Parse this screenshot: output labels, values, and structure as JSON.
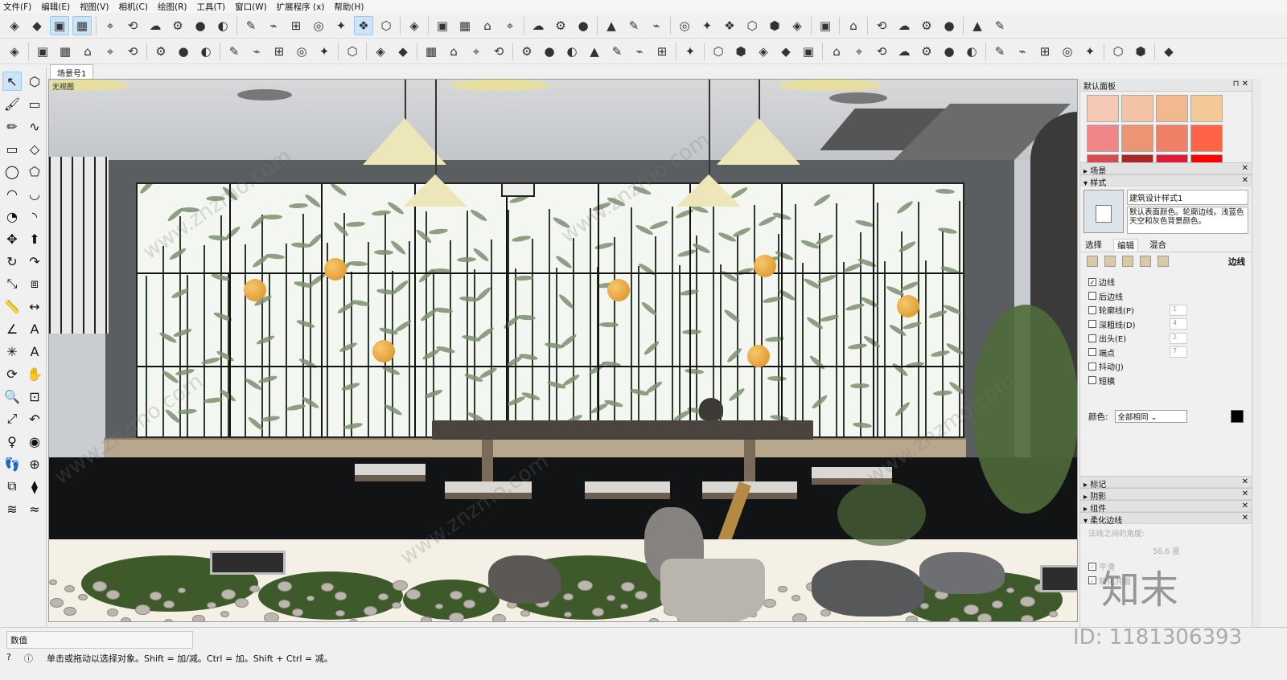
{
  "menu": [
    "文件(F)",
    "编辑(E)",
    "视图(V)",
    "相机(C)",
    "绘图(R)",
    "工具(T)",
    "窗口(W)",
    "扩展程序 (x)",
    "帮助(H)"
  ],
  "toolbar1_icons": [
    "select-icon",
    "box-icon",
    "box-active-icon",
    "box-active2-icon",
    "sep",
    "component-icon",
    "3d-icon",
    "home-icon",
    "toolbox-icon",
    "house-icon",
    "folder-icon",
    "sep",
    "cube-icon",
    "cube-outline-icon",
    "cube-left-icon",
    "cube-right-icon",
    "cube-face-icon",
    "cube-shaded-icon",
    "cube-blue-icon",
    "sep",
    "sandbox-icon",
    "sep",
    "cloud-link-icon",
    "cloud-search-icon",
    "cloud-icon",
    "cloud-share-icon",
    "sep",
    "zoom-extents-icon",
    "network-icon",
    "refresh-check-icon",
    "sep",
    "download-icon",
    "gear-icon",
    "chrome-icon",
    "sep",
    "dot-icon",
    "dot2-icon",
    "dot3-icon",
    "dot4-icon",
    "dot5-icon",
    "pinwheel-icon",
    "sep",
    "ruby-icon",
    "sep",
    "purple-circle-icon",
    "sep",
    "target-icon",
    "camera-icon",
    "camera2-icon",
    "timer-icon",
    "sep",
    "gear2-icon",
    "cube3-icon"
  ],
  "toolbar2_icons": [
    "layers-icon",
    "sep",
    "paper-icon",
    "paper2-icon",
    "paper3-icon",
    "paper4-icon",
    "paper5-icon",
    "sep",
    "vray-icon",
    "refresh-icon",
    "stack-icon",
    "sep",
    "plus-icon",
    "tree-icon",
    "pie-icon",
    "checker-icon",
    "cloud-up-icon",
    "sep",
    "gear3-icon",
    "sep",
    "mail-icon",
    "info-icon",
    "sep",
    "stairs-icon",
    "column-icon",
    "rail-icon",
    "bars-icon",
    "sep",
    "spider-icon",
    "beam-icon",
    "branch-icon",
    "branch2-icon",
    "arch-icon",
    "curl-icon",
    "snake-icon",
    "sep",
    "bench-icon",
    "sep",
    "line-tool-icon",
    "diamond-icon",
    "diamond2-icon",
    "house3-icon",
    "puzzle-icon",
    "sep",
    "arc-icon",
    "dots-icon",
    "wave-icon",
    "spiral-icon",
    "flag-icon",
    "fence-icon",
    "temple-icon",
    "sep",
    "mirror-icon",
    "grid-icon",
    "phone-icon",
    "pen-icon",
    "brush-icon",
    "sep",
    "slide-icon",
    "circle-logo-icon",
    "sep",
    "triangle-icon"
  ],
  "left_tools": [
    "arrow-icon",
    "component-make-icon",
    "paint-icon",
    "eraser-icon",
    "pencil-icon",
    "freehand-icon",
    "rectangle-icon",
    "rotated-rect-icon",
    "circle-icon",
    "polygon-icon",
    "arc-icon",
    "arc2-icon",
    "pie-icon",
    "arc3-icon",
    "move-icon",
    "pushpull-icon",
    "rotate-icon",
    "followme-icon",
    "scale-icon",
    "offset-icon",
    "tape-icon",
    "dimension-icon",
    "protractor-icon",
    "text-icon",
    "axes-icon",
    "3dtext-icon",
    "orbit-icon",
    "pan-icon",
    "zoom-icon",
    "zoom-window-icon",
    "zoom-extents-icon",
    "prev-view-icon",
    "position-camera-icon",
    "look-around-icon",
    "walk-icon",
    "section-icon",
    "sandbox-icon",
    "sandbox2-icon",
    "sandbox3-icon",
    "sandbox4-icon"
  ],
  "scene_tab": "场景号1",
  "viewport_label": "无视图",
  "watermark": "www.znzmo.com",
  "panel": {
    "title": "默认面板",
    "swatches": [
      "#f5c9b3",
      "#f4c3a4",
      "#f2b98f",
      "#f3c996",
      "#f08686",
      "#ec9572",
      "#f07f68",
      "#ff6346",
      "#d94a50",
      "#ad2424",
      "#dd1a37",
      "#ff0000"
    ],
    "sections_top": [
      "场景",
      "样式"
    ],
    "style_name": "建筑设计样式1",
    "style_desc": "默认表面颜色。轮廓边线。浅蓝色天空和灰色背景颜色。",
    "tabs": [
      "选择",
      "编辑",
      "混合"
    ],
    "edit_label": "边线",
    "checks": [
      {
        "label": "边线",
        "checked": true,
        "num": ""
      },
      {
        "label": "后边线",
        "checked": false,
        "num": ""
      },
      {
        "label": "轮廓线(P)",
        "checked": false,
        "num": "1"
      },
      {
        "label": "深粗线(D)",
        "checked": false,
        "num": "4"
      },
      {
        "label": "出头(E)",
        "checked": false,
        "num": "2"
      },
      {
        "label": "端点",
        "checked": false,
        "num": "7"
      },
      {
        "label": "抖动(J)",
        "checked": false,
        "num": ""
      },
      {
        "label": "短横",
        "checked": false,
        "num": ""
      }
    ],
    "color_label": "颜色:",
    "color_value": "全部相同",
    "sections_bottom": [
      "标记",
      "阴影",
      "组件",
      "柔化边线"
    ],
    "soft_edge_label": "法线之间的角度:",
    "soft_edge_value": "56.6 度",
    "smooth": "平滑",
    "soften": "软化共面"
  },
  "status": {
    "field": "数值",
    "message": "单击或拖动以选择对象。Shift = 加/减。Ctrl = 加。Shift + Ctrl = 减。"
  },
  "brand": "知末",
  "id_text": "ID: 1181306393"
}
